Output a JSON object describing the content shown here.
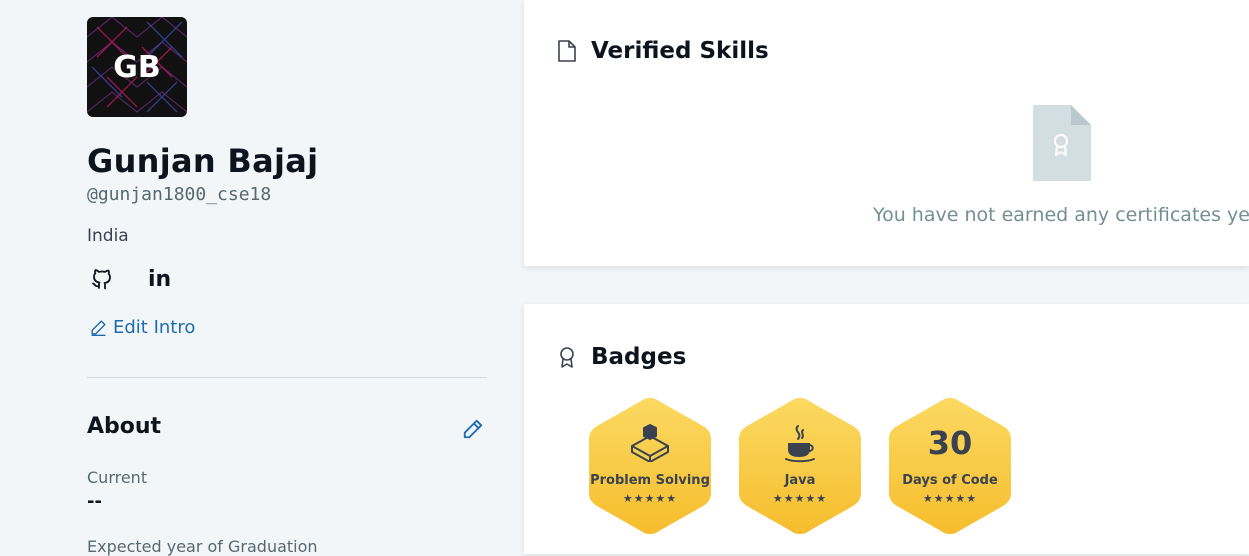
{
  "profile": {
    "initials": "GB",
    "name": "Gunjan Bajaj",
    "username": "@gunjan1800_cse18",
    "country": "India",
    "social": {
      "github_icon": "github-icon",
      "linkedin_text": "in"
    },
    "edit_intro_label": "Edit Intro"
  },
  "about": {
    "title": "About",
    "current_label": "Current",
    "current_value": "--",
    "expected_label": "Expected year of Graduation"
  },
  "verified_skills": {
    "title": "Verified Skills",
    "empty_message": "You have not earned any certificates yet."
  },
  "badges": {
    "title": "Badges",
    "items": [
      {
        "label": "Problem Solving",
        "icon": "cube-icon",
        "stars": "★★★★★",
        "stars_count": 5
      },
      {
        "label": "Java",
        "icon": "java-cup-icon",
        "stars": "★★★★★",
        "stars_count": 5
      },
      {
        "label": "Days of Code",
        "number": "30",
        "stars": "★★★★★",
        "stars_count": 5
      }
    ]
  },
  "colors": {
    "page_bg": "#f3f6f8",
    "link_blue": "#1f6bb0",
    "badge_gold": "#f7c736",
    "badge_gold_light": "#fbd962"
  }
}
